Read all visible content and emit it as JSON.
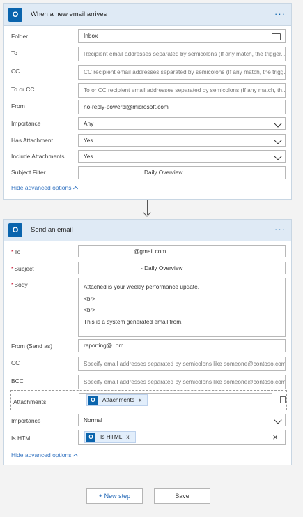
{
  "trigger": {
    "title": "When a new email arrives",
    "menu_icon": "more-dots-icon",
    "fields": {
      "folder": {
        "label": "Folder",
        "value": "Inbox"
      },
      "to": {
        "label": "To",
        "placeholder": "Recipient email addresses separated by semicolons (If any match, the trigger..."
      },
      "cc": {
        "label": "CC",
        "placeholder": "CC recipient email addresses separated by semicolons (If any match, the trigg..."
      },
      "to_or_cc": {
        "label": "To or CC",
        "placeholder": "To or CC recipient email addresses separated by semicolons (If any match, th..."
      },
      "from": {
        "label": "From",
        "value": "no-reply-powerbi@microsoft.com"
      },
      "importance": {
        "label": "Importance",
        "value": "Any"
      },
      "has_attachment": {
        "label": "Has Attachment",
        "value": "Yes"
      },
      "include_attachments": {
        "label": "Include Attachments",
        "value": "Yes"
      },
      "subject_filter": {
        "label": "Subject Filter",
        "value": "Daily Overview"
      }
    },
    "hide_advanced": "Hide advanced options"
  },
  "action": {
    "title": "Send an email",
    "fields": {
      "to": {
        "label": "To",
        "value": "@gmail.com"
      },
      "subject": {
        "label": "Subject",
        "value": "- Daily Overview"
      },
      "body": {
        "label": "Body",
        "lines": [
          "Attached is your weekly performance update.",
          "<br>",
          "<br>",
          "This is a system generated email from."
        ]
      },
      "from_send_as": {
        "label": "From (Send as)",
        "value": "reporting@                    .om"
      },
      "cc": {
        "label": "CC",
        "placeholder": "Specify email addresses separated by semicolons like someone@contoso.com"
      },
      "bcc": {
        "label": "BCC",
        "placeholder": "Specify email addresses separated by semicolons like someone@contoso.com"
      },
      "attachments": {
        "label": "Attachments",
        "token": "Attachments"
      },
      "importance": {
        "label": "Importance",
        "value": "Normal"
      },
      "is_html": {
        "label": "Is HTML",
        "token": "Is HTML"
      }
    },
    "hide_advanced": "Hide advanced options"
  },
  "buttons": {
    "new_step": "+ New step",
    "save": "Save"
  },
  "icons": {
    "token_glyph": "O",
    "remove": "x",
    "card_glyph": "O"
  },
  "colors": {
    "accent": "#0a64ad",
    "header_bg": "#dfeaf5",
    "link": "#3a78c3",
    "required": "#c8102e"
  }
}
